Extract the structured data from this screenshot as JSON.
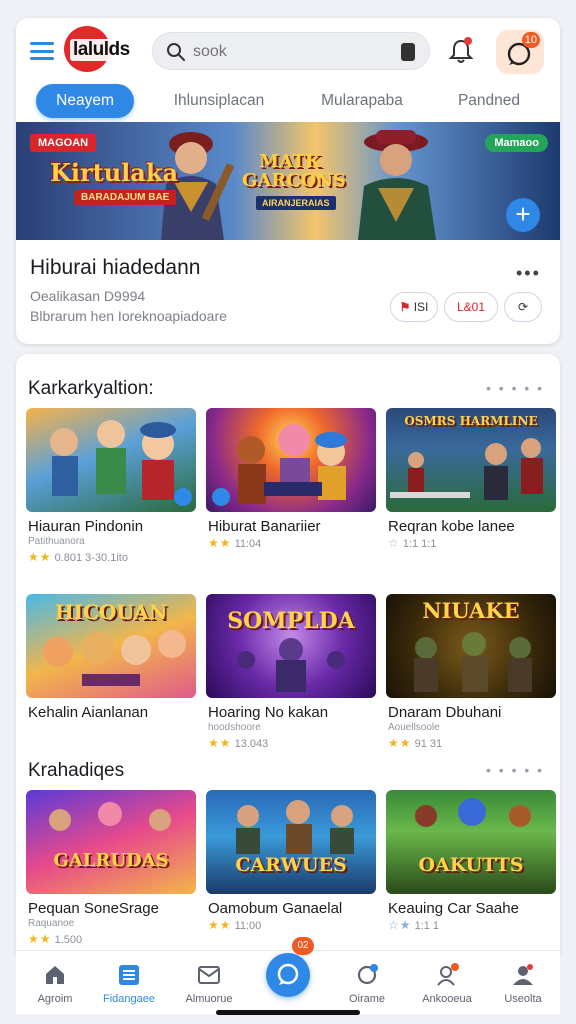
{
  "header": {
    "logo_text": "lalulds",
    "search_placeholder": "sook",
    "chat_badge": "10"
  },
  "tabs": [
    {
      "label": "Neayem",
      "active": true
    },
    {
      "label": "Ihlunsiplacan",
      "active": false
    },
    {
      "label": "Mularapaba",
      "active": false
    },
    {
      "label": "Pandned",
      "active": false
    }
  ],
  "banner": {
    "tag_left": "MAGOAN",
    "title_left": "Kirtulaka",
    "subtitle_left": "BARADAJUM BAE",
    "title_center": "MATK GARCONS",
    "subtitle_center": "AIRANJERAIAS",
    "tag_right": "Mamaoo"
  },
  "info": {
    "title": "Hiburai hiadedann",
    "line1": "Oealikasan D9994",
    "line2": "Blbrarum hen  Ioreknoapiadoare",
    "pill_a": "ISI",
    "pill_b": "L&01"
  },
  "section1": {
    "title": "Karkarkyaltion:",
    "games": [
      {
        "title": "Hiauran Pindonin",
        "sub": "Patithuanora",
        "rating": "0.801 3-30.1ito",
        "thumb": ""
      },
      {
        "title": "Hiburat Banariier",
        "sub": "",
        "rating": "11:04",
        "thumb": ""
      },
      {
        "title": "Reqran kobe lanee",
        "sub": "",
        "rating": "1:1 1:1",
        "thumb": "OSMRS HARMLINE"
      }
    ]
  },
  "section1b": {
    "games": [
      {
        "title": "Kehalin Aianlanan",
        "sub": "",
        "rating": "",
        "thumb": "HICOUAN"
      },
      {
        "title": "Hoaring No kakan",
        "sub": "hoodshoore",
        "rating": "13.043",
        "thumb": "SOMPLDA"
      },
      {
        "title": "Dnaram Dbuhani",
        "sub": "Aouellsoole",
        "rating": "91 31",
        "thumb": "NIUAKE"
      }
    ]
  },
  "section2": {
    "title": "Krahadiqes",
    "games": [
      {
        "title": "Pequan SoneSrage",
        "sub": "Raquanoe",
        "rating": "1.500",
        "thumb": "GALRUDAS"
      },
      {
        "title": "Oamobum Ganaelal",
        "sub": "",
        "rating": "11:00",
        "thumb": "CARWUES"
      },
      {
        "title": "Keauing Car Saahe",
        "sub": "",
        "rating": "1:1 1",
        "thumb": "OAKUTTS"
      }
    ]
  },
  "bottom_nav": {
    "items": [
      {
        "label": "Agroim",
        "icon": "home-icon",
        "active": false
      },
      {
        "label": "Fidangaee",
        "icon": "list-icon",
        "active": true
      },
      {
        "label": "Almuorue",
        "icon": "mail-icon",
        "active": false
      },
      {
        "label": "Oirame",
        "icon": "refresh-icon",
        "active": false
      },
      {
        "label": "Ankooeua",
        "icon": "people-icon",
        "active": false
      },
      {
        "label": "Useolta",
        "icon": "profile-icon",
        "active": false
      }
    ],
    "center_badge": "02"
  },
  "colors": {
    "accent": "#2f88e6",
    "logo_red": "#e02a2a",
    "badge_orange": "#f05a23",
    "star": "#f2b51e"
  }
}
